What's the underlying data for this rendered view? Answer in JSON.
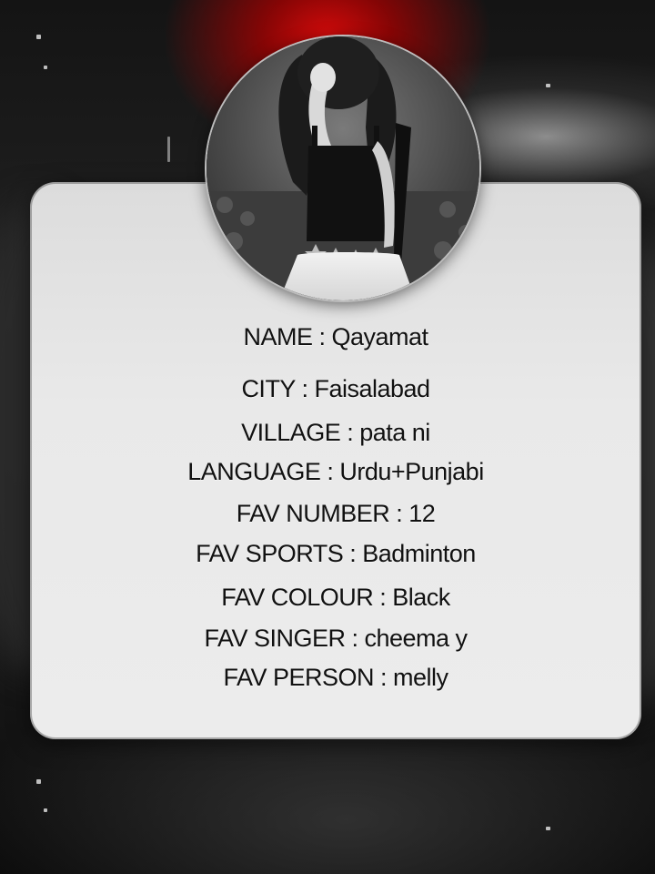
{
  "profile": {
    "avatar_alt": "profile photo",
    "fields": [
      {
        "label": "NAME",
        "value": "Qayamat"
      },
      {
        "label": "CITY",
        "value": "Faisalabad"
      },
      {
        "label": "VILLAGE",
        "value": "pata ni"
      },
      {
        "label": "LANGUAGE",
        "value": "Urdu+Punjabi"
      },
      {
        "label": "FAV NUMBER",
        "value": "12"
      },
      {
        "label": "FAV SPORTS",
        "value": "Badminton"
      },
      {
        "label": "FAV COLOUR",
        "value": "Black"
      },
      {
        "label": "FAV SINGER",
        "value": "cheema y"
      },
      {
        "label": "FAV PERSON",
        "value": "melly"
      }
    ],
    "lines": [
      "NAME : Qayamat",
      "CITY : Faisalabad",
      "VILLAGE : pata ni",
      "LANGUAGE : Urdu+Punjabi",
      "FAV NUMBER : 12",
      "FAV SPORTS : Badminton",
      "FAV COLOUR : Black",
      "FAV SINGER : cheema y",
      "FAV PERSON : melly"
    ]
  },
  "colors": {
    "glow": "#d10a0a",
    "card": "#e6e6e6",
    "text": "#111111"
  }
}
